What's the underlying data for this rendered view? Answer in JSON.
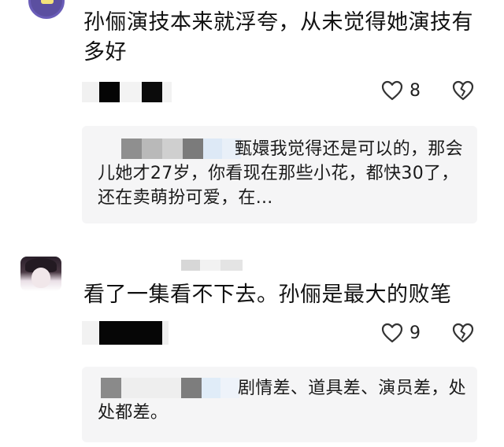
{
  "comments": [
    {
      "avatar_icon": "user-avatar-icon",
      "text": "孙俪演技本来就浮夸，从未觉得她演技有多好",
      "likes": "8",
      "reply": {
        "text": "甄嬛我觉得还是可以的，那会儿她才27岁，你看现在那些小花，都快30了，还在卖萌扮可爱，在..."
      }
    },
    {
      "avatar_icon": "user-avatar-icon",
      "text": "看了一集看不下去。孙俪是最大的败笔",
      "likes": "9",
      "reply": {
        "text": "剧情差、道具差、演员差，处处都差。"
      }
    }
  ],
  "colors": {
    "reply_bg": "#f5f5f6",
    "text": "#111111",
    "icon_stroke": "#333333"
  }
}
